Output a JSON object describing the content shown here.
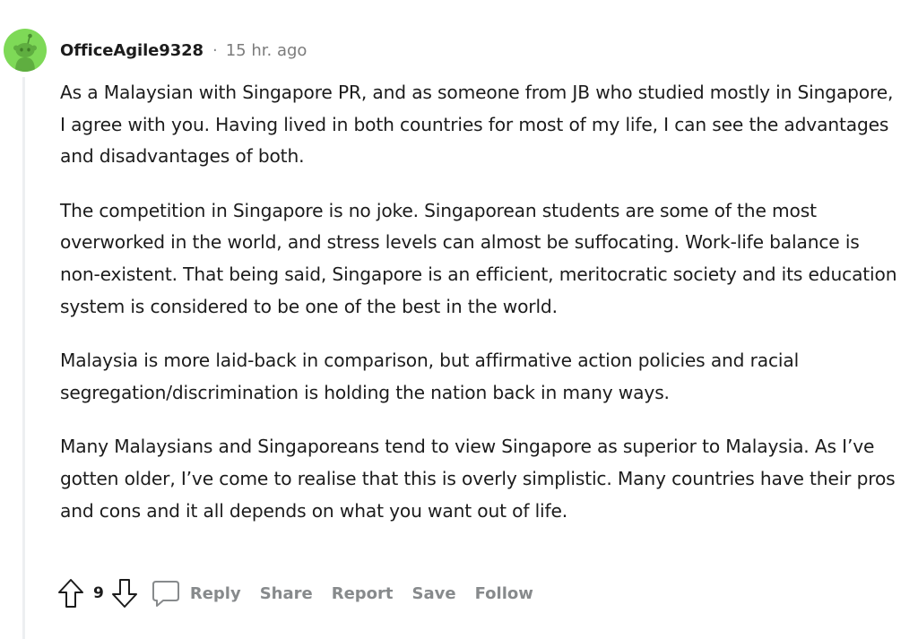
{
  "comment": {
    "author": "OfficeAgile9328",
    "separator": "·",
    "timestamp": "15 hr. ago",
    "paragraphs": [
      "As a Malaysian with Singapore PR, and as someone from JB who studied mostly in Singapore, I agree with you. Having lived in both countries for most of my life, I can see the advantages and disadvantages of both.",
      "The competition in Singapore is no joke. Singaporean students are some of the most overworked in the world, and stress levels can almost be suffocating. Work-life balance is non-existent. That being said, Singapore is an efficient, meritocratic society and its education system is considered to be one of the best in the world.",
      "Malaysia is more laid-back in comparison, but affirmative action policies and racial segregation/discrimination is holding the nation back in many ways.",
      "Many Malaysians and Singaporeans tend to view Singapore as superior to Malaysia. As I’ve gotten older, I’ve come to realise that this is overly simplistic. Many countries have their pros and cons and it all depends on what you want out of life."
    ]
  },
  "actions": {
    "vote_count": "9",
    "reply": "Reply",
    "share": "Share",
    "report": "Report",
    "save": "Save",
    "follow": "Follow"
  },
  "icons": {
    "avatar": "snoo-avatar-icon",
    "upvote": "upvote-arrow-icon",
    "downvote": "downvote-arrow-icon",
    "reply": "speech-bubble-icon"
  },
  "colors": {
    "avatar_bg": "#7ed957",
    "text": "#1c1c1c",
    "muted": "#878a8c",
    "thread_line": "#edeff1"
  }
}
